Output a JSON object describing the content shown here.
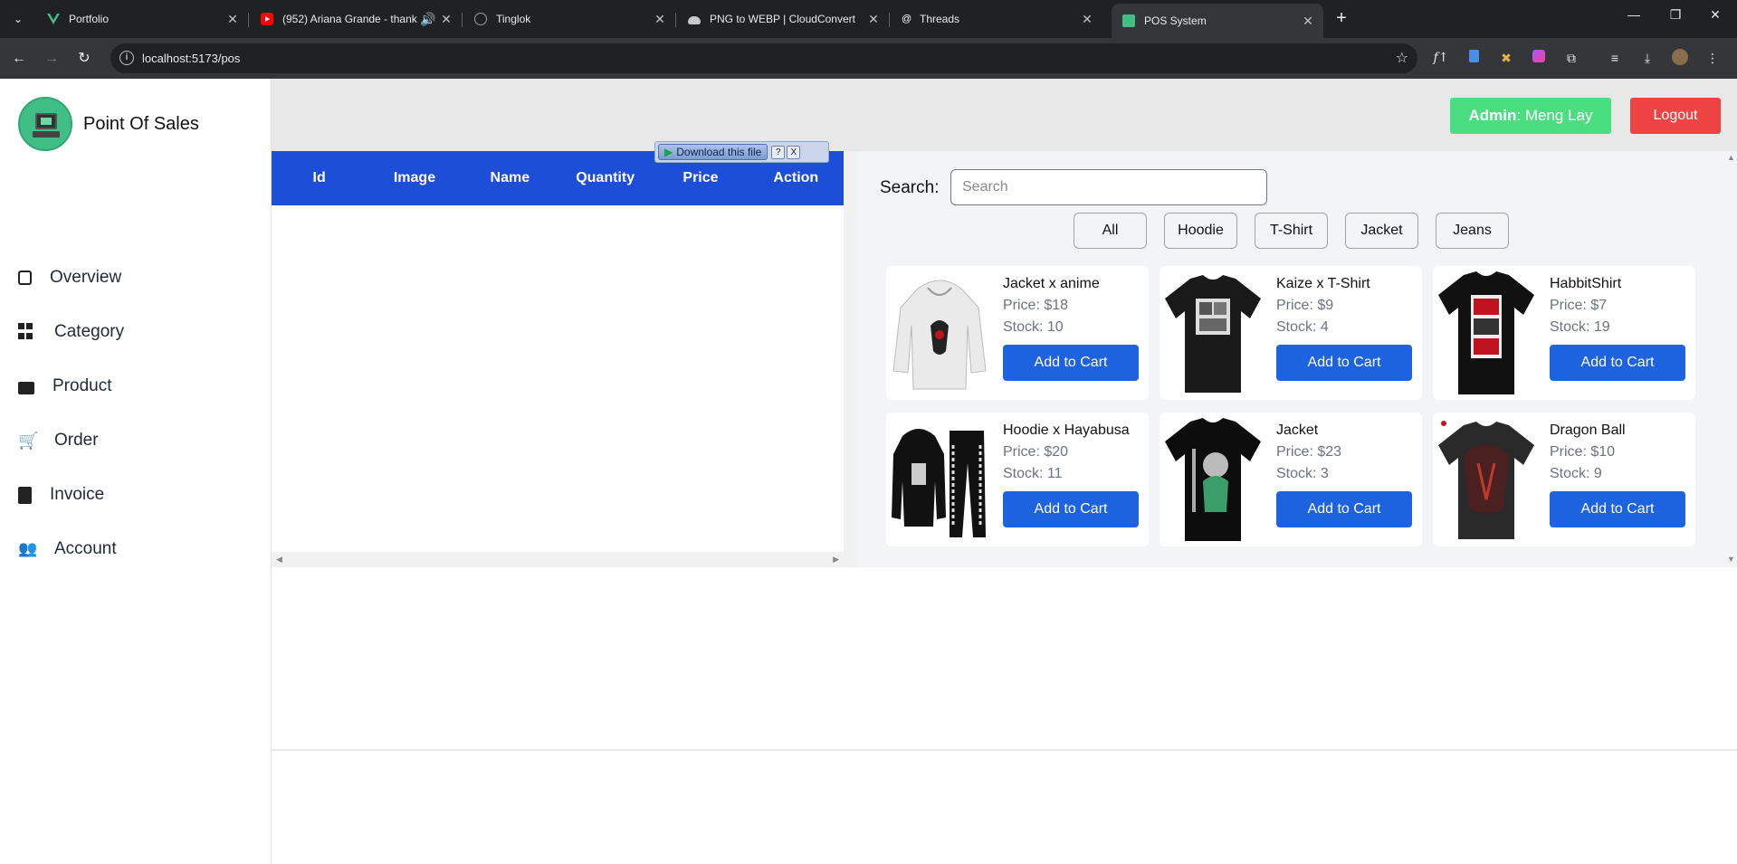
{
  "browser": {
    "tabs": [
      {
        "title": "Portfolio",
        "icon": "vue-logo-icon",
        "color": "#42b883"
      },
      {
        "title": "(952) Ariana Grande - thank",
        "icon": "youtube-icon",
        "color": "#ff0000"
      },
      {
        "title": "Tinglok",
        "icon": "globe-icon",
        "color": "#9aa0a6"
      },
      {
        "title": "PNG to WEBP | CloudConvert",
        "icon": "cloud-icon",
        "color": "#c8c8c8"
      },
      {
        "title": "Threads",
        "icon": "threads-icon",
        "color": "#ffffff"
      },
      {
        "title": "POS System",
        "icon": "pos-icon",
        "color": "#3fbf85",
        "active": true
      }
    ],
    "url": "localhost:5173/pos"
  },
  "sidebar": {
    "brand": "Point Of Sales",
    "items": [
      {
        "label": "Overview",
        "icon": "search-document-icon"
      },
      {
        "label": "Category",
        "icon": "grid-icon"
      },
      {
        "label": "Product",
        "icon": "box-icon"
      },
      {
        "label": "Order",
        "icon": "cart-icon"
      },
      {
        "label": "Invoice",
        "icon": "invoice-icon"
      },
      {
        "label": "Account",
        "icon": "users-icon"
      }
    ]
  },
  "topbar": {
    "admin_prefix": "Admin",
    "admin_name": ": Meng Lay",
    "logout": "Logout",
    "admin_color": "#4ade80",
    "logout_color": "#ef4444"
  },
  "cart": {
    "columns": [
      "Id",
      "Image",
      "Name",
      "Quantity",
      "Price",
      "Action"
    ],
    "rows": [],
    "header_color": "#1d4ed8"
  },
  "download_popup": {
    "label": "Download this file",
    "help": "?",
    "close": "X"
  },
  "products": {
    "search_label": "Search:",
    "search_placeholder": "Search",
    "search_value": "",
    "filters": [
      "All",
      "Hoodie",
      "T-Shirt",
      "Jacket",
      "Jeans"
    ],
    "add_label": "Add to Cart",
    "items": [
      {
        "name": "Jacket x anime",
        "price": "Price: $18",
        "stock": "Stock: 10",
        "image": "white-hoodie-icon"
      },
      {
        "name": "Kaize x T-Shirt",
        "price": "Price: $9",
        "stock": "Stock: 4",
        "image": "black-tshirt-icon"
      },
      {
        "name": "HabbitShirt",
        "price": "Price: $7",
        "stock": "Stock: 19",
        "image": "black-tshirt-red-print-icon"
      },
      {
        "name": "Hoodie x Hayabusa",
        "price": "Price: $20",
        "stock": "Stock: 11",
        "image": "black-hoodie-set-icon"
      },
      {
        "name": "Jacket",
        "price": "Price: $23",
        "stock": "Stock: 3",
        "image": "black-tshirt-anime-icon"
      },
      {
        "name": "Dragon Ball",
        "price": "Price: $10",
        "stock": "Stock: 9",
        "image": "dark-tshirt-dragon-icon"
      }
    ]
  }
}
